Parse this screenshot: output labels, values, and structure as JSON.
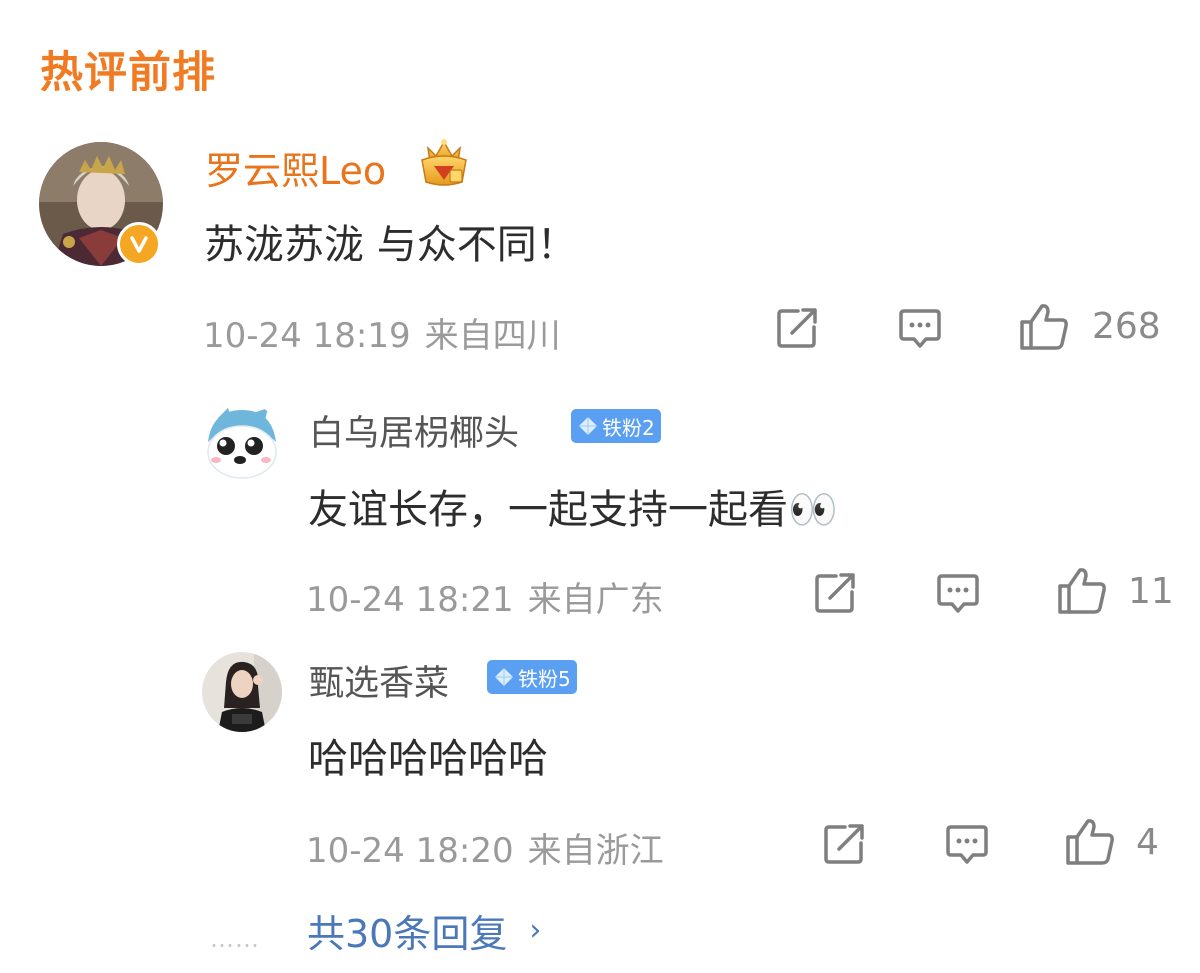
{
  "section_title": "热评前排",
  "main_comment": {
    "author": "罗云熙Leo",
    "text": "苏泷苏泷 与众不同！",
    "time": "10-24 18:19",
    "location": "来自四川",
    "likes": "268",
    "avatar_icon": "user-photo-avatar",
    "verified_icon": "verified-v-badge",
    "crown_icon": "fan-crown-badge"
  },
  "replies": [
    {
      "author": "白乌居枴椰头",
      "badge": "铁粉2",
      "text": "友谊长存，一起支持一起看👀",
      "time": "10-24 18:21",
      "location": "来自广东",
      "likes": "11"
    },
    {
      "author": "甄选香菜",
      "badge": "铁粉5",
      "text": "哈哈哈哈哈哈",
      "time": "10-24 18:20",
      "location": "来自浙江",
      "likes": "4"
    }
  ],
  "more": {
    "dots": "……",
    "label": "共30条回复",
    "chevron": "›"
  },
  "colors": {
    "title_orange": "#f07b22",
    "author_orange": "#e8741c",
    "badge_blue": "#5b9ff2",
    "link_blue": "#4a78b8",
    "meta_gray": "#9a9a9a"
  }
}
